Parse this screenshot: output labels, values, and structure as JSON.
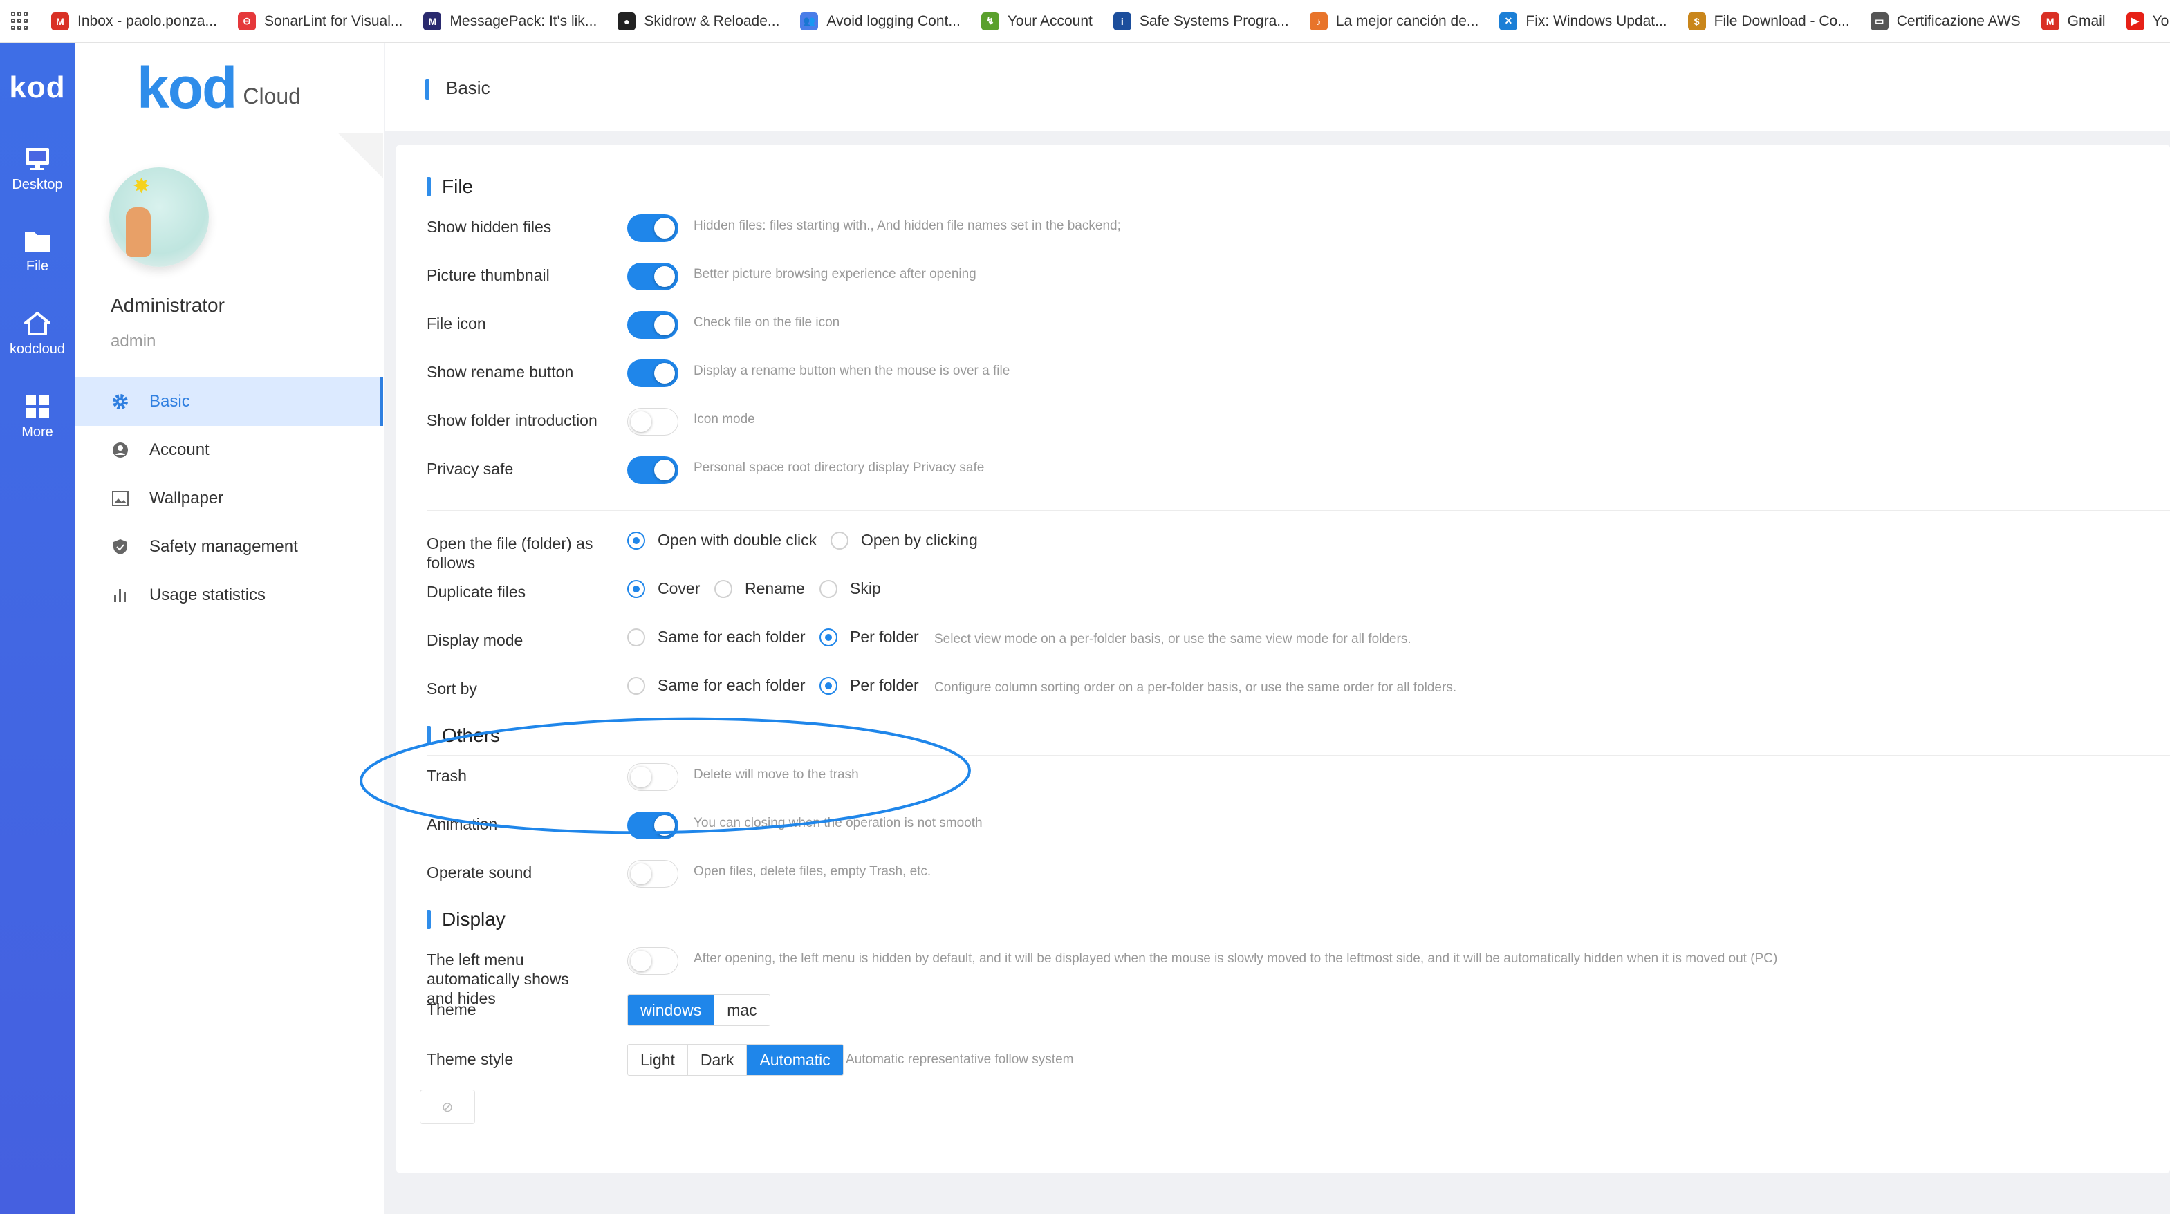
{
  "bookmarks": [
    {
      "label": "Inbox - paolo.ponza...",
      "icon": "gmail-icon",
      "color": "#d93025",
      "glyph": "M"
    },
    {
      "label": "SonarLint for Visual...",
      "icon": "sonarlint-icon",
      "color": "#e5383b",
      "glyph": "⊖"
    },
    {
      "label": "MessagePack: It's lik...",
      "icon": "messagepack-icon",
      "color": "#2a2a6e",
      "glyph": "M"
    },
    {
      "label": "Skidrow & Reloade...",
      "icon": "skidrow-icon",
      "color": "#222222",
      "glyph": "●"
    },
    {
      "label": "Avoid logging Cont...",
      "icon": "people-icon",
      "color": "#4a7de8",
      "glyph": "👥"
    },
    {
      "label": "Your Account",
      "icon": "account-icon",
      "color": "#5aa02c",
      "glyph": "↯"
    },
    {
      "label": "Safe Systems Progra...",
      "icon": "info-icon",
      "color": "#1c4e9c",
      "glyph": "i"
    },
    {
      "label": "La mejor canción de...",
      "icon": "song-icon",
      "color": "#e8742a",
      "glyph": "♪"
    },
    {
      "label": "Fix: Windows Updat...",
      "icon": "windows-icon",
      "color": "#1b7fd6",
      "glyph": "✕"
    },
    {
      "label": "File Download - Co...",
      "icon": "download-icon",
      "color": "#c9861b",
      "glyph": "$"
    },
    {
      "label": "Certificazione AWS",
      "icon": "folder-icon",
      "color": "#555555",
      "glyph": "▭"
    },
    {
      "label": "Gmail",
      "icon": "gmail-icon",
      "color": "#d93025",
      "glyph": "M"
    },
    {
      "label": "Yo",
      "icon": "youtube-icon",
      "color": "#e62117",
      "glyph": "▶"
    }
  ],
  "rail": {
    "logo": "kod",
    "items": [
      {
        "label": "Desktop",
        "icon": "desktop-icon"
      },
      {
        "label": "File",
        "icon": "folder-icon"
      },
      {
        "label": "kodcloud",
        "icon": "home-icon"
      },
      {
        "label": "More",
        "icon": "grid-icon"
      }
    ]
  },
  "sidebar": {
    "brand_main": "kod",
    "brand_sub": "Cloud",
    "user_name": "Administrator",
    "user_id": "admin",
    "items": [
      {
        "label": "Basic",
        "icon": "gear-icon",
        "active": true
      },
      {
        "label": "Account",
        "icon": "user-icon",
        "active": false
      },
      {
        "label": "Wallpaper",
        "icon": "image-icon",
        "active": false
      },
      {
        "label": "Safety management",
        "icon": "shield-icon",
        "active": false
      },
      {
        "label": "Usage statistics",
        "icon": "bar-chart-icon",
        "active": false
      }
    ]
  },
  "header": {
    "title": "Basic"
  },
  "file_section": {
    "title": "File",
    "toggles": [
      {
        "label": "Show hidden files",
        "on": true,
        "desc": "Hidden files: files starting with., And hidden file names set in the backend;"
      },
      {
        "label": "Picture thumbnail",
        "on": true,
        "desc": "Better picture browsing experience after opening"
      },
      {
        "label": "File icon",
        "on": true,
        "desc": "Check file on the file icon"
      },
      {
        "label": "Show rename button",
        "on": true,
        "desc": "Display a rename button when the mouse is over a file"
      },
      {
        "label": "Show folder introduction",
        "on": false,
        "desc": "Icon mode"
      },
      {
        "label": "Privacy safe",
        "on": true,
        "desc": "Personal space root directory display Privacy safe"
      }
    ],
    "open_file": {
      "label": "Open the file (folder) as follows",
      "options": [
        "Open with double click",
        "Open by clicking"
      ],
      "selected": 0
    },
    "duplicate": {
      "label": "Duplicate files",
      "options": [
        "Cover",
        "Rename",
        "Skip"
      ],
      "selected": 0
    },
    "display_mode": {
      "label": "Display mode",
      "options": [
        "Same for each folder",
        "Per folder"
      ],
      "selected": 1,
      "desc": "Select view mode on a per-folder basis, or use the same view mode for all folders."
    },
    "sort_by": {
      "label": "Sort by",
      "options": [
        "Same for each folder",
        "Per folder"
      ],
      "selected": 1,
      "desc": "Configure column sorting order on a per-folder basis, or use the same order for all folders."
    }
  },
  "others_section": {
    "title": "Others",
    "toggles": [
      {
        "label": "Trash",
        "on": false,
        "desc": "Delete will move to the trash"
      },
      {
        "label": "Animation",
        "on": true,
        "desc": "You can closing when the operation is not smooth"
      },
      {
        "label": "Operate sound",
        "on": false,
        "desc": "Open files, delete files, empty Trash, etc."
      }
    ]
  },
  "display_section": {
    "title": "Display",
    "left_menu": {
      "label": "The left menu automatically shows and hides",
      "on": false,
      "desc": "After opening, the left menu is hidden by default, and it will be displayed when the mouse is slowly moved to the leftmost side, and it will be automatically hidden when it is moved out (PC)"
    },
    "theme": {
      "label": "Theme",
      "options": [
        "windows",
        "mac"
      ],
      "selected": 0
    },
    "theme_style": {
      "label": "Theme style",
      "options": [
        "Light",
        "Dark",
        "Automatic"
      ],
      "selected": 2,
      "desc": "Automatic representative follow system"
    }
  },
  "colors": {
    "accent": "#1f86ea",
    "rail": "#4560e0",
    "annotation": "#1f86ea"
  }
}
